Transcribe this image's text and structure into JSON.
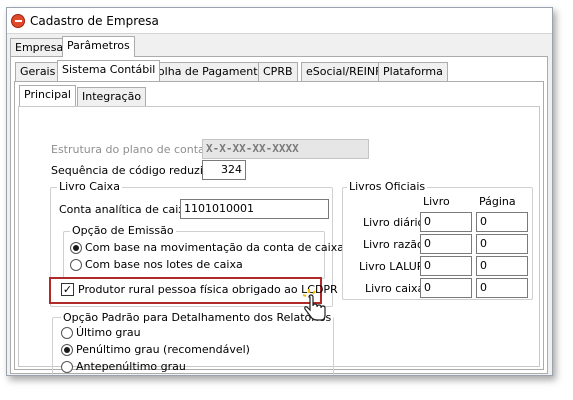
{
  "window": {
    "title": "Cadastro de Empresa"
  },
  "tabs_top": [
    {
      "label": "Empresa"
    },
    {
      "label": "Parâmetros"
    }
  ],
  "tabs_mid": [
    {
      "label": "Gerais"
    },
    {
      "label": "Sistema Contábil"
    },
    {
      "label": "Folha de Pagamento"
    },
    {
      "label": "CPRB"
    },
    {
      "label": "eSocial/REINF"
    },
    {
      "label": "Plataforma"
    }
  ],
  "tabs_sub": [
    {
      "label": "Principal"
    },
    {
      "label": "Integração"
    }
  ],
  "fields": {
    "estrutura_label": "Estrutura do plano de contas",
    "estrutura_value": "X-X-XX-XX-XXXX",
    "sequencia_label": "Sequência de código reduzido",
    "sequencia_value": "324"
  },
  "livro_caixa": {
    "title": "Livro Caixa",
    "conta_label": "Conta analítica de caixa",
    "conta_value": "1101010001",
    "opcao_title": "Opção de Emissão",
    "opcao_options": [
      {
        "label": "Com base na movimentação da conta de caixa",
        "selected": true
      },
      {
        "label": "Com base nos lotes de caixa",
        "selected": false
      }
    ]
  },
  "produtor": {
    "label": "Produtor rural pessoa física obrigado ao LCDPR",
    "checked": true,
    "check_glyph": "✓"
  },
  "opcao_padrao": {
    "title": "Opção Padrão para Detalhamento dos Relatórios",
    "options": [
      {
        "label": "Último grau",
        "selected": false
      },
      {
        "label": "Penúltimo grau (recomendável)",
        "selected": true
      },
      {
        "label": "Antepenúltimo grau",
        "selected": false
      }
    ]
  },
  "livros": {
    "title": "Livros Oficiais",
    "col_livro": "Livro",
    "col_pagina": "Página",
    "rows": [
      {
        "label": "Livro diário",
        "livro": "0",
        "pagina": "0"
      },
      {
        "label": "Livro razão",
        "livro": "0",
        "pagina": "0"
      },
      {
        "label": "Livro LALUR",
        "livro": "0",
        "pagina": "0"
      },
      {
        "label": "Livro caixa",
        "livro": "0",
        "pagina": "0"
      }
    ]
  },
  "colors": {
    "highlight": "#b02a2a",
    "app_icon": "#e04a2a"
  },
  "icons": {
    "app": "app-logo-icon",
    "cursor": "hand-pointer-icon"
  }
}
